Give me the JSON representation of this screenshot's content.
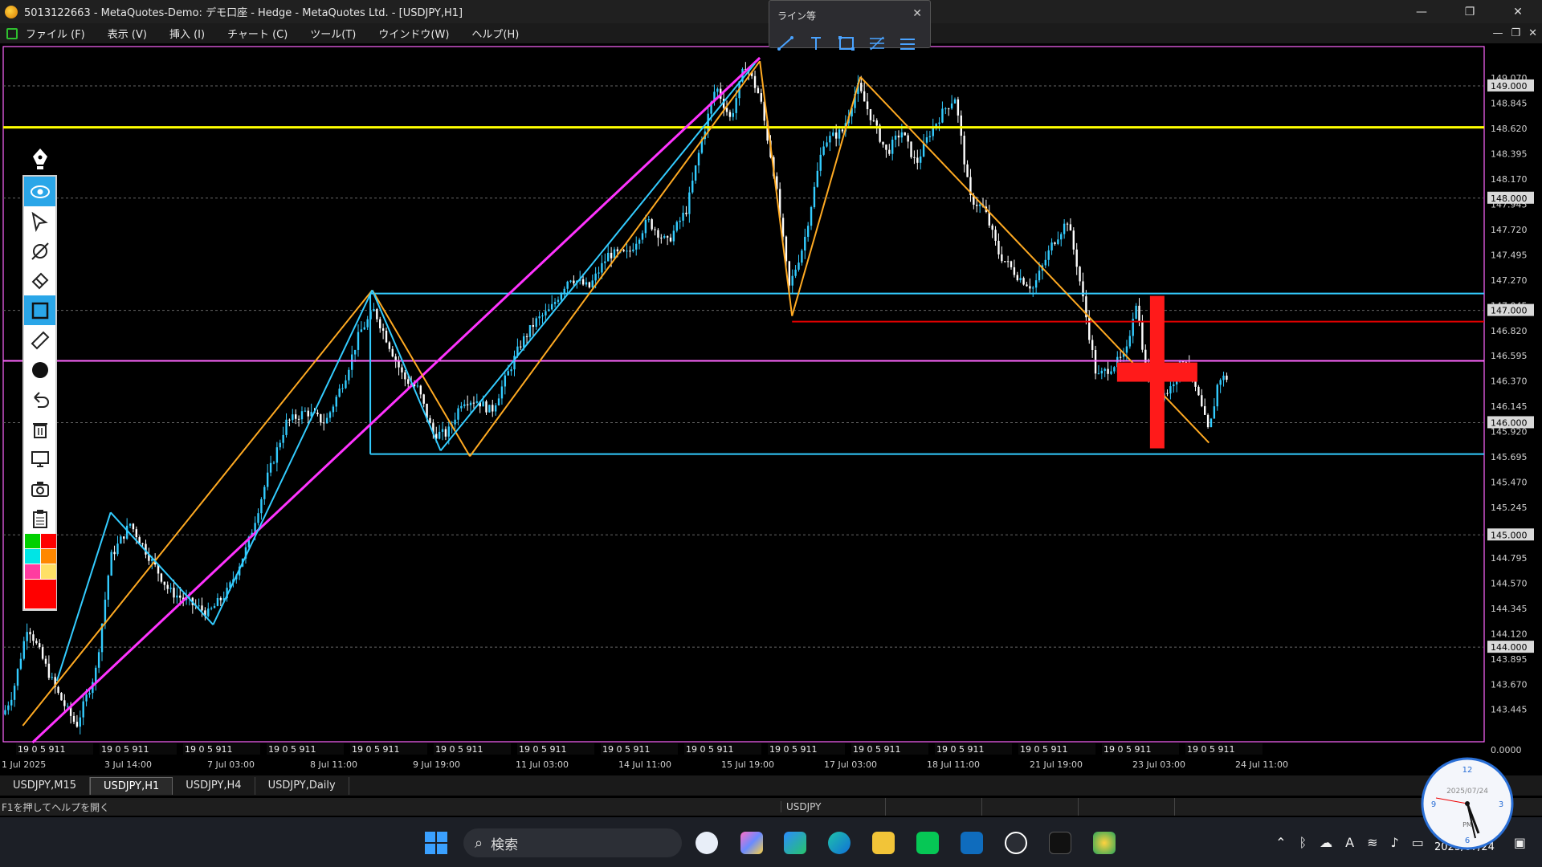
{
  "window": {
    "title": "5013122663 - MetaQuotes-Demo: デモ口座 - Hedge - MetaQuotes Ltd. - [USDJPY,H1]",
    "minimize": "—",
    "restore": "❐",
    "close": "✕"
  },
  "menu": {
    "items": [
      "ファイル (F)",
      "表示 (V)",
      "挿入 (I)",
      "チャート (C)",
      "ツール(T)",
      "ウインドウ(W)",
      "ヘルプ(H)"
    ],
    "mdi": [
      "—",
      "❐",
      "✕"
    ]
  },
  "line_panel": {
    "title": "ライン等",
    "close": "✕",
    "tools": [
      "trendline-icon",
      "text-icon",
      "rectangle-icon",
      "fibonacci-icon",
      "channel-icon"
    ]
  },
  "draw_toolbar": {
    "tools": [
      "eye-icon",
      "cursor-icon",
      "crosshair-icon",
      "eraser-icon",
      "rectangle-icon",
      "ruler-icon",
      "dot-icon",
      "undo-icon",
      "trash-icon",
      "screen-icon",
      "camera-icon",
      "clipboard-icon"
    ],
    "active": "eye-icon",
    "swatches": [
      "#00d000",
      "#ff0000",
      "#00e5e5",
      "#ff8800",
      "#ff3ca0",
      "#ffe066"
    ],
    "selected_color": "#ff0000"
  },
  "chart_data": {
    "type": "candlestick",
    "symbol": "USDJPY",
    "timeframe": "H1",
    "ylim": [
      143.3,
      149.35
    ],
    "y_ticks": [
      "149.070",
      "148.845",
      "148.620",
      "148.395",
      "148.170",
      "147.945",
      "147.720",
      "147.495",
      "147.270",
      "147.045",
      "146.820",
      "146.595",
      "146.370",
      "146.145",
      "145.920",
      "145.695",
      "145.470",
      "145.245",
      "145.020",
      "144.795",
      "144.570",
      "144.345",
      "144.120",
      "143.895",
      "143.670",
      "143.445",
      "0.0000"
    ],
    "price_tags": [
      "149.000",
      "148.000",
      "147.000",
      "146.000",
      "145.000",
      "144.000"
    ],
    "x_ticks": [
      "1 Jul 2025",
      "3 Jul 14:00",
      "7 Jul 03:00",
      "8 Jul 11:00",
      "9 Jul 19:00",
      "11 Jul 03:00",
      "14 Jul 11:00",
      "15 Jul 19:00",
      "17 Jul 03:00",
      "18 Jul 11:00",
      "21 Jul 19:00",
      "23 Jul 03:00",
      "24 Jul 11:00"
    ],
    "hour_strip_label": "19 0 5 911",
    "horizontal_lines": [
      {
        "price": 148.63,
        "color": "#ffff00",
        "role": "resistance"
      },
      {
        "price": 146.55,
        "color": "#ff66ff",
        "role": "level"
      },
      {
        "price": 147.15,
        "color": "#33ccff",
        "role": "range-top"
      },
      {
        "price": 145.72,
        "color": "#33ccff",
        "role": "range-bottom"
      },
      {
        "price": 146.9,
        "color": "#e00000",
        "role": "level"
      }
    ],
    "price_path": [
      [
        0,
        143.4
      ],
      [
        10,
        143.6
      ],
      [
        25,
        144.2
      ],
      [
        40,
        143.9
      ],
      [
        55,
        143.6
      ],
      [
        75,
        143.3
      ],
      [
        95,
        143.8
      ],
      [
        110,
        144.8
      ],
      [
        130,
        145.1
      ],
      [
        150,
        144.8
      ],
      [
        170,
        144.5
      ],
      [
        190,
        144.4
      ],
      [
        210,
        144.3
      ],
      [
        230,
        144.5
      ],
      [
        250,
        144.9
      ],
      [
        270,
        145.5
      ],
      [
        290,
        146.0
      ],
      [
        310,
        146.1
      ],
      [
        330,
        146.0
      ],
      [
        350,
        146.4
      ],
      [
        365,
        146.8
      ],
      [
        380,
        147.0
      ],
      [
        395,
        146.7
      ],
      [
        410,
        146.4
      ],
      [
        425,
        146.3
      ],
      [
        440,
        145.9
      ],
      [
        455,
        145.9
      ],
      [
        470,
        146.2
      ],
      [
        485,
        146.2
      ],
      [
        500,
        146.1
      ],
      [
        515,
        146.4
      ],
      [
        530,
        146.7
      ],
      [
        545,
        146.9
      ],
      [
        560,
        147.0
      ],
      [
        580,
        147.3
      ],
      [
        600,
        147.2
      ],
      [
        620,
        147.5
      ],
      [
        640,
        147.5
      ],
      [
        660,
        147.8
      ],
      [
        680,
        147.6
      ],
      [
        700,
        147.9
      ],
      [
        715,
        148.5
      ],
      [
        730,
        149.0
      ],
      [
        745,
        148.7
      ],
      [
        760,
        149.2
      ],
      [
        775,
        148.9
      ],
      [
        790,
        148.2
      ],
      [
        805,
        147.2
      ],
      [
        820,
        147.6
      ],
      [
        840,
        148.5
      ],
      [
        860,
        148.6
      ],
      [
        875,
        149.0
      ],
      [
        890,
        148.7
      ],
      [
        905,
        148.4
      ],
      [
        920,
        148.6
      ],
      [
        935,
        148.3
      ],
      [
        950,
        148.6
      ],
      [
        965,
        148.8
      ],
      [
        975,
        148.9
      ],
      [
        990,
        148.0
      ],
      [
        1005,
        147.9
      ],
      [
        1020,
        147.5
      ],
      [
        1040,
        147.3
      ],
      [
        1055,
        147.2
      ],
      [
        1075,
        147.6
      ],
      [
        1090,
        147.8
      ],
      [
        1100,
        147.4
      ],
      [
        1110,
        146.9
      ],
      [
        1120,
        146.4
      ],
      [
        1135,
        146.5
      ],
      [
        1150,
        146.6
      ],
      [
        1160,
        147.1
      ],
      [
        1170,
        146.5
      ],
      [
        1180,
        146.2
      ],
      [
        1195,
        146.3
      ],
      [
        1210,
        146.6
      ],
      [
        1225,
        146.2
      ],
      [
        1235,
        145.9
      ],
      [
        1245,
        146.4
      ],
      [
        1255,
        146.4
      ]
    ],
    "ohlc_from_path": true,
    "trend_lines": [
      {
        "color": "#ff33ff",
        "from": [
          30,
          143.15
        ],
        "to": [
          775,
          149.25
        ]
      },
      {
        "color": "#ffaa22",
        "from": [
          20,
          143.3
        ],
        "to": [
          378,
          147.18
        ]
      },
      {
        "color": "#ffaa22",
        "from": [
          378,
          147.18
        ],
        "to": [
          478,
          145.7
        ]
      },
      {
        "color": "#ffaa22",
        "from": [
          478,
          145.7
        ],
        "to": [
          775,
          149.22
        ]
      },
      {
        "color": "#ffaa22",
        "from": [
          775,
          149.22
        ],
        "to": [
          808,
          146.95
        ]
      },
      {
        "color": "#ffaa22",
        "from": [
          808,
          146.95
        ],
        "to": [
          878,
          149.08
        ]
      },
      {
        "color": "#ffaa22",
        "from": [
          878,
          149.08
        ],
        "to": [
          1235,
          145.82
        ]
      },
      {
        "color": "#33ccff",
        "from": [
          55,
          143.7
        ],
        "to": [
          110,
          145.2
        ]
      },
      {
        "color": "#33ccff",
        "from": [
          110,
          145.2
        ],
        "to": [
          215,
          144.2
        ]
      },
      {
        "color": "#33ccff",
        "from": [
          215,
          144.2
        ],
        "to": [
          378,
          147.18
        ]
      },
      {
        "color": "#33ccff",
        "from": [
          378,
          147.18
        ],
        "to": [
          448,
          145.75
        ]
      },
      {
        "color": "#33ccff",
        "from": [
          448,
          145.75
        ],
        "to": [
          770,
          149.2
        ]
      }
    ],
    "marker": {
      "type": "cross",
      "color": "#ff1a1a",
      "at": [
        1182,
        146.45
      ]
    }
  },
  "bottom_tabs": [
    "USDJPY,M15",
    "USDJPY,H1",
    "USDJPY,H4",
    "USDJPY,Daily"
  ],
  "active_tab": "USDJPY,H1",
  "status": {
    "help": "F1を押してヘルプを開く",
    "symbol": "USDJPY"
  },
  "taskbar": {
    "search": "検索",
    "date": "2025/07/24",
    "clock_face_date": "2025/07/24",
    "clock_pm": "PM"
  }
}
